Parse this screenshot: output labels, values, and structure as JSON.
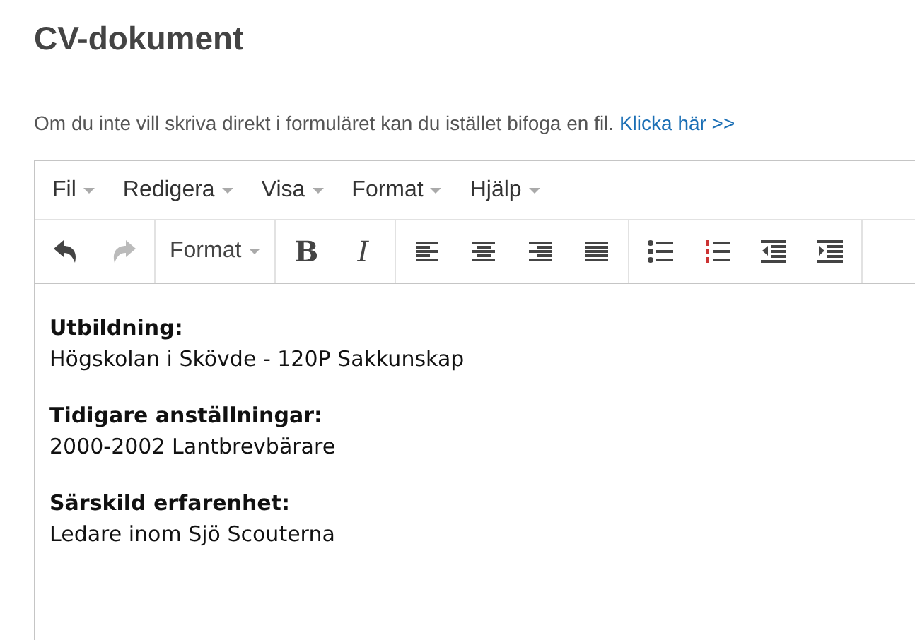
{
  "heading": "CV-dokument",
  "intro": {
    "text": "Om du inte vill skriva direkt i formuläret kan du istället bifoga en fil.",
    "link": "Klicka här >>"
  },
  "menubar": [
    {
      "label": "Fil"
    },
    {
      "label": "Redigera"
    },
    {
      "label": "Visa"
    },
    {
      "label": "Format"
    },
    {
      "label": "Hjälp"
    }
  ],
  "toolbar": [
    [
      {
        "kind": "undo",
        "disabled": false
      },
      {
        "kind": "redo",
        "disabled": true
      }
    ],
    [
      {
        "kind": "dropdown",
        "label": "Format",
        "disabled": false
      }
    ],
    [
      {
        "kind": "bold",
        "label": "B",
        "disabled": false
      },
      {
        "kind": "italic",
        "label": "I",
        "disabled": false
      }
    ],
    [
      {
        "kind": "align-left",
        "disabled": false
      },
      {
        "kind": "align-center",
        "disabled": false
      },
      {
        "kind": "align-right",
        "disabled": false
      },
      {
        "kind": "justify",
        "disabled": false
      }
    ],
    [
      {
        "kind": "bullet-list",
        "disabled": false
      },
      {
        "kind": "numbered-list",
        "disabled": false
      },
      {
        "kind": "outdent",
        "disabled": false
      },
      {
        "kind": "indent",
        "disabled": false
      }
    ]
  ],
  "content": [
    {
      "heading": "Utbildning:",
      "text": "Högskolan i Skövde - 120P Sakkunskap"
    },
    {
      "heading": "Tidigare anställningar:",
      "text": "2000-2002 Lantbrevbärare"
    },
    {
      "heading": "Särskild erfarenhet:",
      "text": "Ledare inom Sjö Scouterna"
    }
  ]
}
